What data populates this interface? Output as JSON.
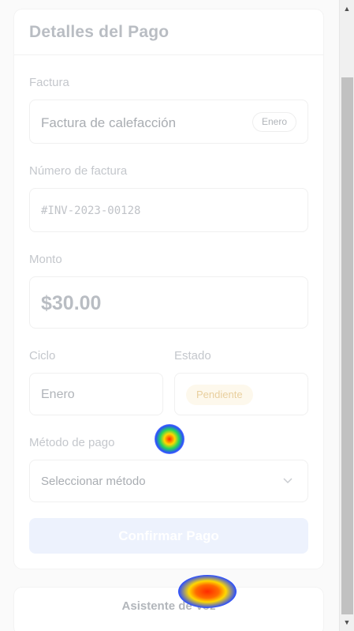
{
  "card": {
    "title": "Detalles del Pago",
    "invoice_label": "Factura",
    "invoice_value": "Factura de calefacción",
    "invoice_month_pill": "Enero",
    "number_label": "Número de factura",
    "number_value": "#INV-2023-00128",
    "amount_label": "Monto",
    "amount_value": "$30.00",
    "cycle_label": "Ciclo",
    "cycle_value": "Enero",
    "status_label": "Estado",
    "status_value": "Pendiente",
    "method_label": "Método de pago",
    "method_placeholder": "Seleccionar método",
    "confirm_label": "Confirmar Pago"
  },
  "voice": {
    "label": "Asistente de Voz"
  },
  "colors": {
    "confirm_bg": "#edf2fd",
    "status_bg": "#fdf8ec",
    "status_text": "#e9cf9e"
  },
  "icons": {
    "method_chevron": "chevron-down-icon",
    "scroll_up": "triangle-up-icon",
    "scroll_down": "triangle-down-icon"
  }
}
